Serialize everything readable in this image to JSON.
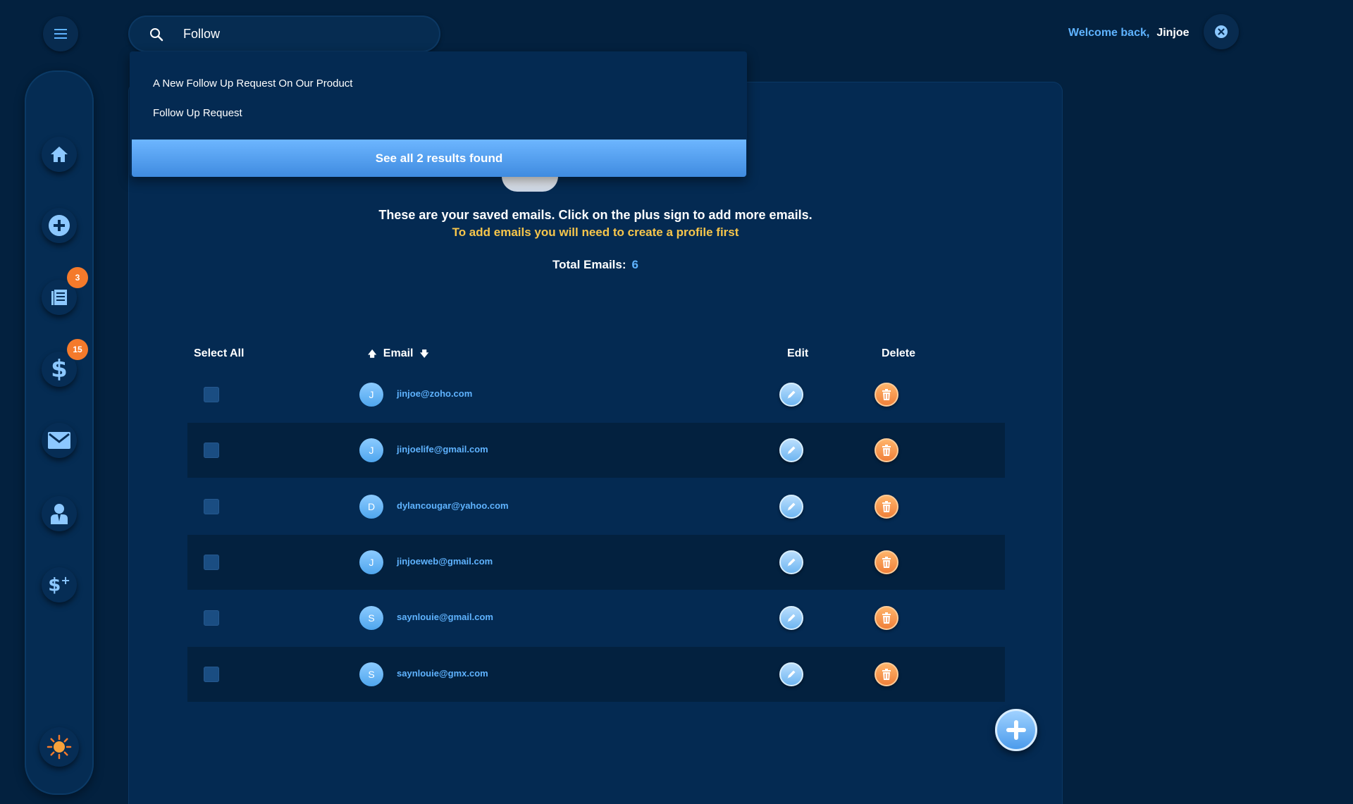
{
  "search": {
    "value": "Follow"
  },
  "header": {
    "welcome": "Welcome back,",
    "username": "Jinjoe"
  },
  "sidebar": {
    "items": [
      {
        "name": "home"
      },
      {
        "name": "add"
      },
      {
        "name": "notes",
        "badge": "3"
      },
      {
        "name": "billing",
        "badge": "15"
      },
      {
        "name": "mail"
      },
      {
        "name": "profile"
      },
      {
        "name": "pricing"
      }
    ]
  },
  "dropdown": {
    "results": [
      "A New Follow Up Request On Our Product",
      "Follow Up Request"
    ],
    "footer": "See all 2 results found"
  },
  "main": {
    "message": "These are your saved emails. Click on the plus sign to add more emails.",
    "warning": "To add emails you will need to create a profile first",
    "total_label": "Total Emails:",
    "total_value": "6",
    "table": {
      "headers": {
        "select_all": "Select All",
        "email": "Email",
        "edit": "Edit",
        "delete": "Delete"
      },
      "rows": [
        {
          "initial": "J",
          "email": "jinjoe@zoho.com"
        },
        {
          "initial": "J",
          "email": "jinjoelife@gmail.com"
        },
        {
          "initial": "D",
          "email": "dylancougar@yahoo.com"
        },
        {
          "initial": "J",
          "email": "jinjoeweb@gmail.com"
        },
        {
          "initial": "S",
          "email": "saynlouie@gmail.com"
        },
        {
          "initial": "S",
          "email": "saynlouie@gmx.com"
        }
      ]
    }
  },
  "colors": {
    "accent": "#5fb3ff",
    "warning": "#f7c64b",
    "danger": "#f47a2b",
    "background": "#03213f"
  }
}
